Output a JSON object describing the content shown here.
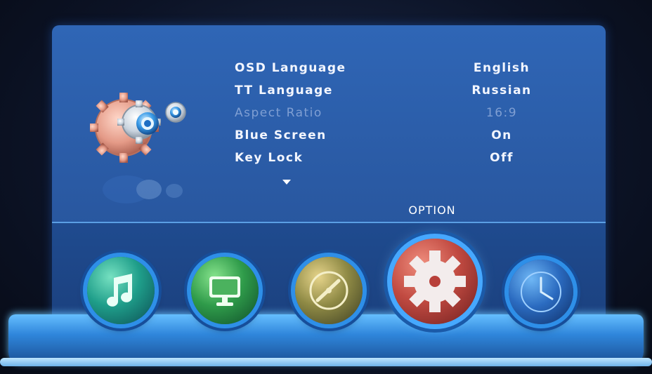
{
  "menu": {
    "section_title": "OPTION",
    "items": [
      {
        "label": "OSD Language",
        "value": "English",
        "enabled": true
      },
      {
        "label": "TT Language",
        "value": "Russian",
        "enabled": true
      },
      {
        "label": "Aspect Ratio",
        "value": "16:9",
        "enabled": false
      },
      {
        "label": "Blue Screen",
        "value": "On",
        "enabled": true
      },
      {
        "label": "Key Lock",
        "value": "Off",
        "enabled": true
      }
    ]
  },
  "nav": {
    "buttons": [
      {
        "icon": "music-note-icon",
        "selected": false
      },
      {
        "icon": "monitor-icon",
        "selected": false
      },
      {
        "icon": "tuning-dial-icon",
        "selected": false
      },
      {
        "icon": "gear-icon",
        "selected": true
      },
      {
        "icon": "clock-icon",
        "selected": false
      }
    ]
  },
  "colors": {
    "panel": "#2f66b6",
    "panel_lower": "#1f4b8f",
    "stage": "#66bfff",
    "text": "#f3f6ff",
    "text_disabled": "#7f9fd3",
    "selected_button": "#c14a41"
  }
}
